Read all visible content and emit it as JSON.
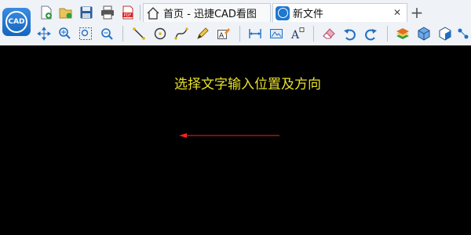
{
  "app": {
    "logo_text": "CAD",
    "name": "迅捷CAD看图"
  },
  "tabs": [
    {
      "label": "首页 - 迅捷CAD看图",
      "icon": "home-icon",
      "active": false
    },
    {
      "label": "新文件",
      "icon": "cad-file-icon",
      "active": true,
      "close_label": "✕"
    }
  ],
  "new_tab_label": "+",
  "quick_toolbar": [
    "new-file-icon",
    "open-file-icon",
    "save-icon",
    "print-icon",
    "pdf-export-icon"
  ],
  "draw_toolbar": [
    "pan-icon",
    "zoom-icon",
    "zoom-window-icon",
    "zoom-extents-icon",
    "line-icon",
    "circle-icon",
    "polyline-icon",
    "pencil-icon",
    "text-edit-icon",
    "measure-icon",
    "area-icon",
    "text-style-icon",
    "eraser-icon",
    "undo-icon",
    "redo-icon",
    "layers-icon",
    "3d-box-icon",
    "3d-view-icon",
    "more-icon"
  ],
  "canvas": {
    "prompt": "选择文字输入位置及方向",
    "prompt_color": "#e8e02a",
    "arrow_color": "#ff2020",
    "background": "#000000"
  }
}
